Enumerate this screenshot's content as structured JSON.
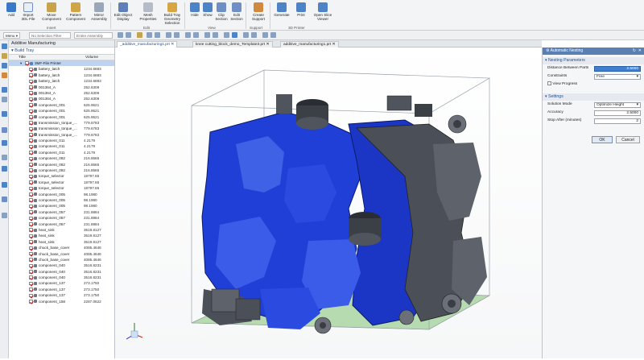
{
  "ribbon": {
    "buttons": [
      {
        "id": "add",
        "label": "Add"
      },
      {
        "id": "import",
        "label": "Import\n3DL File"
      },
      {
        "id": "move",
        "label": "Move\nComponent"
      },
      {
        "id": "pattern",
        "label": "Pattern\nComponent"
      },
      {
        "id": "mirror",
        "label": "Mirror\nAssembly"
      },
      {
        "id": "editdisplay",
        "label": "Edit Object\nDisplay"
      },
      {
        "id": "meshprops",
        "label": "Mesh\nProperties"
      },
      {
        "id": "buildtray",
        "label": "Build Tray\nGeometry Selection"
      },
      {
        "id": "hide",
        "label": "Hide"
      },
      {
        "id": "show",
        "label": "Show"
      },
      {
        "id": "clip",
        "label": "Clip\nSection"
      },
      {
        "id": "editsection",
        "label": "Edit\nSection"
      },
      {
        "id": "support",
        "label": "Create\nSupport"
      },
      {
        "id": "generate",
        "label": "Generate"
      },
      {
        "id": "print",
        "label": "Print"
      },
      {
        "id": "openviewer",
        "label": "Open Slice\nViewer"
      }
    ],
    "groups": {
      "insert": "Insert",
      "edit": "Edit",
      "view": "View",
      "support": "Support",
      "printer": "3D Printer"
    }
  },
  "toolbar": {
    "menu": "Menu",
    "filter": "No Selection Filter",
    "scope": "Entire Assembly"
  },
  "tabs": [
    "_additive_manufacturing1.prt",
    "knee cutting_block_demo_Template3.prt",
    "additive_manufacturing1.prt"
  ],
  "panel": {
    "title": "Additive Manufacturing",
    "subtitle": "Build Tray",
    "col_title": "Title",
    "col_volume": "Volume",
    "root": "3MF-File Printer",
    "rows": [
      {
        "name": "battery_latch",
        "volume": "1234.6883"
      },
      {
        "name": "battery_latch",
        "volume": "1234.6883"
      },
      {
        "name": "battery_latch",
        "volume": "1234.6883"
      },
      {
        "name": "001364_A",
        "volume": "252.6309"
      },
      {
        "name": "001364_A",
        "volume": "252.6309"
      },
      {
        "name": "001364_A",
        "volume": "252.6309"
      },
      {
        "name": "component_001",
        "volume": "625.9521"
      },
      {
        "name": "component_001",
        "volume": "625.9521"
      },
      {
        "name": "component_001",
        "volume": "625.9521"
      },
      {
        "name": "transmission_torque_...",
        "volume": "779.6783"
      },
      {
        "name": "transmission_torque_...",
        "volume": "779.6783"
      },
      {
        "name": "transmission_torque_...",
        "volume": "779.6783"
      },
      {
        "name": "component_011",
        "volume": "4.2179"
      },
      {
        "name": "component_011",
        "volume": "4.2179"
      },
      {
        "name": "component_011",
        "volume": "4.2179"
      },
      {
        "name": "component_082",
        "volume": "216.8565"
      },
      {
        "name": "component_082",
        "volume": "216.8565"
      },
      {
        "name": "component_082",
        "volume": "216.8565"
      },
      {
        "name": "torque_selector",
        "volume": "18797.65"
      },
      {
        "name": "torque_selector",
        "volume": "18797.65"
      },
      {
        "name": "torque_selector",
        "volume": "18797.65"
      },
      {
        "name": "component_005",
        "volume": "98.1980"
      },
      {
        "name": "component_005",
        "volume": "98.1980"
      },
      {
        "name": "component_005",
        "volume": "98.1980"
      },
      {
        "name": "component_057",
        "volume": "231.8884"
      },
      {
        "name": "component_057",
        "volume": "231.8884"
      },
      {
        "name": "component_057",
        "volume": "231.8884"
      },
      {
        "name": "heat_sink",
        "volume": "3519.8127"
      },
      {
        "name": "heat_sink",
        "volume": "3519.8127"
      },
      {
        "name": "heat_sink",
        "volume": "3519.8127"
      },
      {
        "name": "chuck_base_cover",
        "volume": "4085.4646"
      },
      {
        "name": "chuck_base_cover",
        "volume": "4085.4646"
      },
      {
        "name": "chuck_base_cover",
        "volume": "4085.4646"
      },
      {
        "name": "component_040",
        "volume": "3516.8231"
      },
      {
        "name": "component_040",
        "volume": "3516.8231"
      },
      {
        "name": "component_040",
        "volume": "3516.8231"
      },
      {
        "name": "component_137",
        "volume": "273.1750"
      },
      {
        "name": "component_137",
        "volume": "273.1750"
      },
      {
        "name": "component_137",
        "volume": "273.1750"
      },
      {
        "name": "component_158",
        "volume": "2287.0622"
      }
    ]
  },
  "dialog": {
    "title": "Automatic Nesting",
    "section1": "Nesting Parameters",
    "distance_label": "Distance Between Parts",
    "distance_value": "2.5000",
    "constraints_label": "Constraints",
    "constraints_value": "Free",
    "view_progress": "View Progress",
    "section2": "Settings",
    "solution_label": "Solution Mode",
    "solution_value": "Optimize Height",
    "accuracy_label": "Accuracy",
    "accuracy_value": "2.5000",
    "stop_label": "Stop After (minutes)",
    "stop_value": "2",
    "ok": "OK",
    "cancel": "Cancel"
  },
  "colors": {
    "accent": "#1d4f91",
    "blue_part": "#1f3fd6",
    "grey_part": "#4b4f57",
    "tray": "#b6dbb0"
  }
}
